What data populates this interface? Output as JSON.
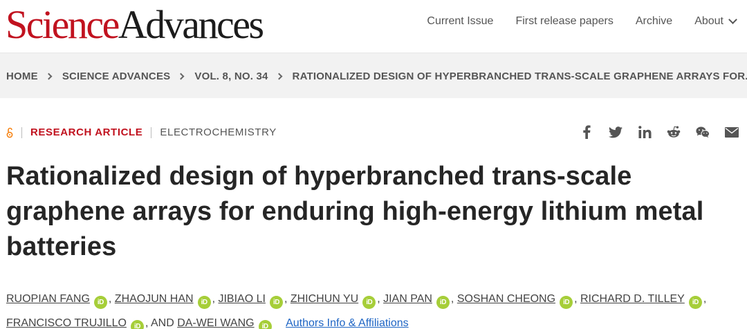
{
  "header": {
    "logo_science": "Science",
    "logo_advances": "Advances",
    "nav": [
      "Current Issue",
      "First release papers",
      "Archive",
      "About"
    ]
  },
  "breadcrumb": [
    "HOME",
    "SCIENCE ADVANCES",
    "VOL. 8, NO. 34",
    "RATIONALIZED DESIGN OF HYPERBRANCHED TRANS-SCALE GRAPHENE ARRAYS FOR..."
  ],
  "meta": {
    "article_type": "RESEARCH ARTICLE",
    "subject": "ELECTROCHEMISTRY"
  },
  "share_icons": [
    "facebook-icon",
    "twitter-icon",
    "linkedin-icon",
    "reddit-icon",
    "wechat-icon",
    "email-icon"
  ],
  "title": "Rationalized design of hyperbranched trans-scale graphene arrays for enduring high-energy lithium metal batteries",
  "authors": [
    "RUOPIAN FANG",
    "ZHAOJUN HAN",
    "JIBIAO LI",
    "ZHICHUN YU",
    "JIAN PAN",
    "SOSHAN CHEONG",
    "RICHARD D. TILLEY",
    "FRANCISCO TRUJILLO",
    "DA-WEI WANG"
  ],
  "author_joiner": "AND",
  "orcid_label": "iD",
  "affiliations_link": "Authors Info & Affiliations",
  "colors": {
    "brand_red": "#c1121f",
    "orcid_green": "#a6ce39",
    "link_blue": "#1d64c4",
    "open_access_orange": "#f68212"
  }
}
